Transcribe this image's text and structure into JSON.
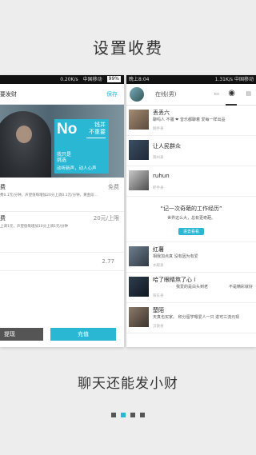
{
  "top_title": "设置收费",
  "bottom_title": "聊天还能发小财",
  "left": {
    "status": {
      "speed": "0.20K/s",
      "carrier": "中国移动",
      "battery": "99%"
    },
    "header_title": "要发财",
    "save": "保存",
    "poster": {
      "big": "No",
      "line1": "钱并",
      "line2": "不重要",
      "sub1": "我只是",
      "sub2": "挑选",
      "sub3": "动听新声，动人心声"
    },
    "fee_label": "费",
    "fee_value": "免费",
    "fee_note": "费0.1元/分钟，声望值每增加20分上调0.1元/分钟，黄金段...",
    "fee2_label": "费",
    "fee2_value": "20元/上限",
    "fee2_note": "上调1元，声望值每增加10分上调1元/分钟",
    "amount": "2.77",
    "btn_withdraw": "提现",
    "btn_recharge": "充值"
  },
  "right": {
    "status": {
      "time": "晚上8:04",
      "speed": "1.31K/s",
      "carrier": "中国移动"
    },
    "online": "在线(男)",
    "feed": [
      {
        "name": "丢丢六",
        "sub": "聊吗人 不骚 ❤ 音乐都聊着 爱每一样出品",
        "meta": "刚手县"
      },
      {
        "name": "让人民群众",
        "sub": "",
        "meta": "滁州县"
      },
      {
        "name": "ruhun",
        "sub": "",
        "meta": "盱手县"
      }
    ],
    "banner": {
      "quote": "“记一次奇葩的工作经历”",
      "sub": "世界这么大，总有更奇葩。",
      "button": "进去看看"
    },
    "feed2": [
      {
        "name": "红薯",
        "sub": "相我加点真 没有因为有爱",
        "meta": "水殿县",
        "right": ""
      },
      {
        "name": "哈了眼睛熬了心 i",
        "sub": "我爱的是白头到老",
        "meta": "阳东县",
        "right": "不是精彩就好"
      },
      {
        "name": "楚陌",
        "sub": "天真也买家。 积分留学嗯爱人一只 进可三流元现",
        "meta": "汉敦县",
        "right": ""
      }
    ]
  }
}
